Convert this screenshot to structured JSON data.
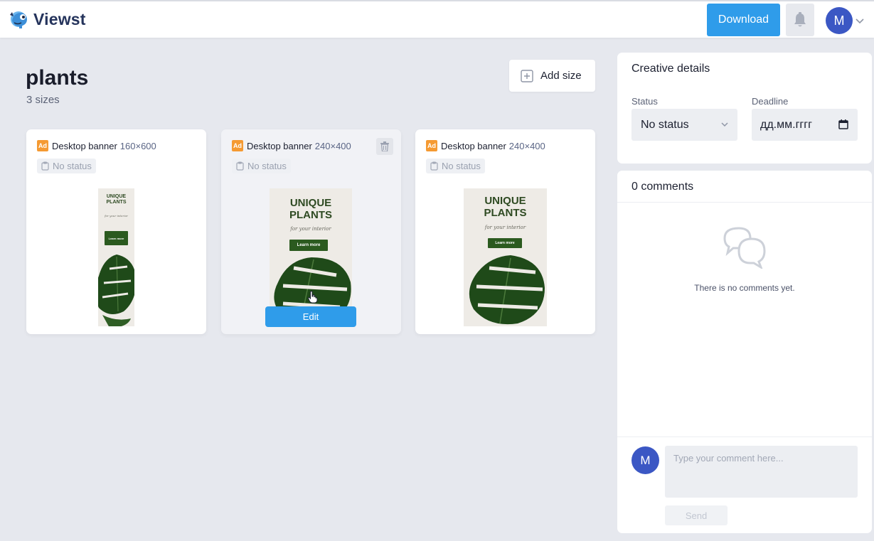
{
  "app": {
    "name": "Viewst"
  },
  "header": {
    "download_label": "Download",
    "avatar_initial": "M"
  },
  "project": {
    "title": "plants",
    "sizes_label": "3 sizes",
    "add_size_label": "Add size"
  },
  "cards": [
    {
      "badge": "Ad",
      "type": "Desktop banner",
      "size": "160×600",
      "status": "No status",
      "banner": {
        "title_line1": "UNIQUE",
        "title_line2": "PLANTS",
        "subtitle": "for your interior",
        "cta": "Learn more"
      }
    },
    {
      "badge": "Ad",
      "type": "Desktop banner",
      "size": "240×400",
      "status": "No status",
      "edit_label": "Edit",
      "banner": {
        "title_line1": "UNIQUE",
        "title_line2": "PLANTS",
        "subtitle": "for your interior",
        "cta": "Learn more"
      }
    },
    {
      "badge": "Ad",
      "type": "Desktop banner",
      "size": "240×400",
      "status": "No status",
      "banner": {
        "title_line1": "UNIQUE",
        "title_line2": "PLANTS",
        "subtitle": "for your interior",
        "cta": "Learn more"
      }
    }
  ],
  "details": {
    "title": "Creative details",
    "status_label": "Status",
    "status_value": "No status",
    "deadline_label": "Deadline",
    "deadline_placeholder": "дд.мм.гггг"
  },
  "comments": {
    "title": "0 comments",
    "empty_text": "There is no comments yet.",
    "avatar_initial": "M",
    "input_placeholder": "Type your comment here...",
    "send_label": "Send"
  },
  "colors": {
    "accent": "#2f9cea",
    "avatar": "#3b57c4",
    "ad_badge": "#f59a32",
    "banner_green": "#2b5a1f"
  }
}
